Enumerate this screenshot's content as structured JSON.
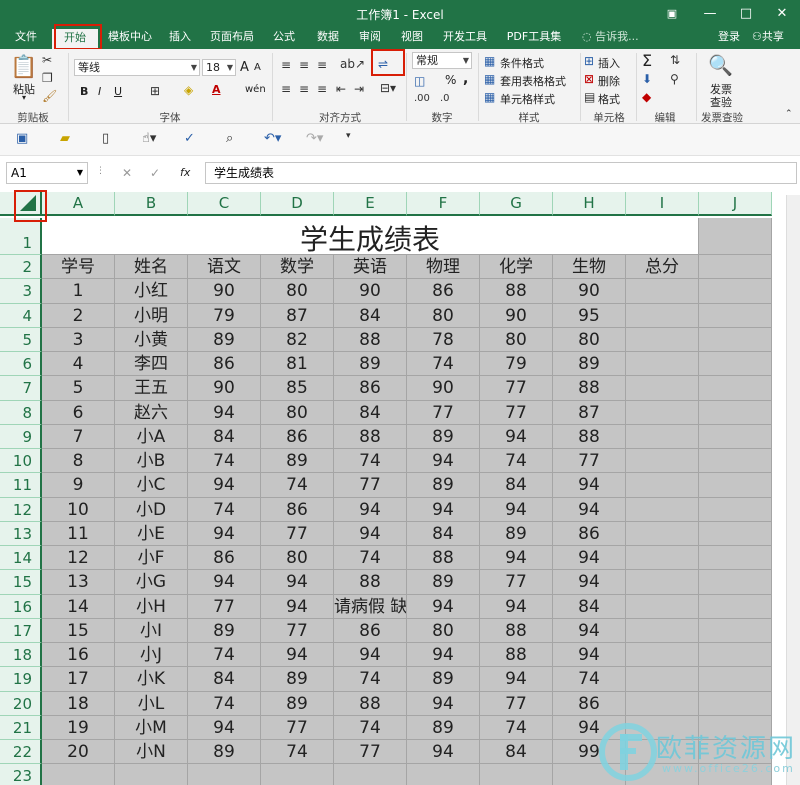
{
  "window": {
    "title": "工作簿1 - Excel",
    "restore_icon": "ribbon-display-icon",
    "minimize": "—",
    "maximize": "□",
    "close": "✕"
  },
  "tabs": [
    {
      "label": "文件"
    },
    {
      "label": "开始"
    },
    {
      "label": "模板中心"
    },
    {
      "label": "插入"
    },
    {
      "label": "页面布局"
    },
    {
      "label": "公式"
    },
    {
      "label": "数据"
    },
    {
      "label": "审阅"
    },
    {
      "label": "视图"
    },
    {
      "label": "开发工具"
    },
    {
      "label": "PDF工具集"
    }
  ],
  "search": {
    "label": "告诉我..."
  },
  "account": {
    "login": "登录",
    "share": "共享"
  },
  "ribbon": {
    "clipboard": {
      "paste": "粘贴",
      "label": "剪贴板"
    },
    "font": {
      "name": "等线",
      "size": "18",
      "label": "字体",
      "bold": "B",
      "italic": "I",
      "underline": "U",
      "grow": "A",
      "shrink": "A",
      "font_color": "A",
      "phonetic": "wén"
    },
    "alignment": {
      "label": "对齐方式"
    },
    "number": {
      "format": "常规",
      "percent": "%",
      "comma": ",",
      "label": "数字"
    },
    "styles": {
      "conditional": "条件格式",
      "table": "套用表格格式",
      "cell": "单元格样式",
      "label": "样式"
    },
    "cells": {
      "insert": "插入",
      "delete": "删除",
      "format": "格式",
      "label": "单元格"
    },
    "editing": {
      "sum": "Σ",
      "label": "编辑"
    },
    "invoice": {
      "button_line1": "发票",
      "button_line2": "查验",
      "label": "发票查验"
    }
  },
  "formula_bar": {
    "name_box": "A1",
    "cancel": "✕",
    "enter": "✓",
    "fx": "fx",
    "content": "学生成绩表"
  },
  "sheet": {
    "columns": [
      "A",
      "B",
      "C",
      "D",
      "E",
      "F",
      "G",
      "H",
      "I",
      "J"
    ],
    "rows": [
      "1",
      "2",
      "3",
      "4",
      "5",
      "6",
      "7",
      "8",
      "9",
      "10",
      "11",
      "12",
      "13",
      "14",
      "15",
      "16",
      "17",
      "18",
      "19",
      "20",
      "21",
      "22",
      "23"
    ],
    "title": "学生成绩表",
    "headers": [
      "学号",
      "姓名",
      "语文",
      "数学",
      "英语",
      "物理",
      "化学",
      "生物",
      "总分"
    ],
    "data": [
      [
        "1",
        "小红",
        "90",
        "80",
        "90",
        "86",
        "88",
        "90"
      ],
      [
        "2",
        "小明",
        "79",
        "87",
        "84",
        "80",
        "90",
        "95"
      ],
      [
        "3",
        "小黄",
        "89",
        "82",
        "88",
        "78",
        "80",
        "80"
      ],
      [
        "4",
        "李四",
        "86",
        "81",
        "89",
        "74",
        "79",
        "89"
      ],
      [
        "5",
        "王五",
        "90",
        "85",
        "86",
        "90",
        "77",
        "88"
      ],
      [
        "6",
        "赵六",
        "94",
        "80",
        "84",
        "77",
        "77",
        "87"
      ],
      [
        "7",
        "小A",
        "84",
        "86",
        "88",
        "89",
        "94",
        "88"
      ],
      [
        "8",
        "小B",
        "74",
        "89",
        "74",
        "94",
        "74",
        "77"
      ],
      [
        "9",
        "小C",
        "94",
        "74",
        "77",
        "89",
        "84",
        "94"
      ],
      [
        "10",
        "小D",
        "74",
        "86",
        "94",
        "94",
        "94",
        "94"
      ],
      [
        "11",
        "小E",
        "94",
        "77",
        "94",
        "84",
        "89",
        "86"
      ],
      [
        "12",
        "小F",
        "86",
        "80",
        "74",
        "88",
        "94",
        "94"
      ],
      [
        "13",
        "小G",
        "94",
        "94",
        "88",
        "89",
        "77",
        "94"
      ],
      [
        "14",
        "小H",
        "77",
        "94",
        "请病假 缺考",
        "94",
        "94",
        "84"
      ],
      [
        "15",
        "小I",
        "89",
        "77",
        "86",
        "80",
        "88",
        "94"
      ],
      [
        "16",
        "小J",
        "74",
        "94",
        "94",
        "94",
        "88",
        "94"
      ],
      [
        "17",
        "小K",
        "84",
        "89",
        "74",
        "89",
        "94",
        "74"
      ],
      [
        "18",
        "小L",
        "74",
        "89",
        "88",
        "94",
        "77",
        "86"
      ],
      [
        "19",
        "小M",
        "94",
        "77",
        "74",
        "89",
        "74",
        "94"
      ],
      [
        "20",
        "小N",
        "89",
        "74",
        "77",
        "94",
        "84",
        "99"
      ]
    ]
  },
  "watermark": {
    "text": "欧菲资源网",
    "url": "www.office26.com"
  },
  "colors": {
    "excel_green": "#217346",
    "highlight": "#d81e06",
    "selection_gray": "#c5c5c5"
  }
}
